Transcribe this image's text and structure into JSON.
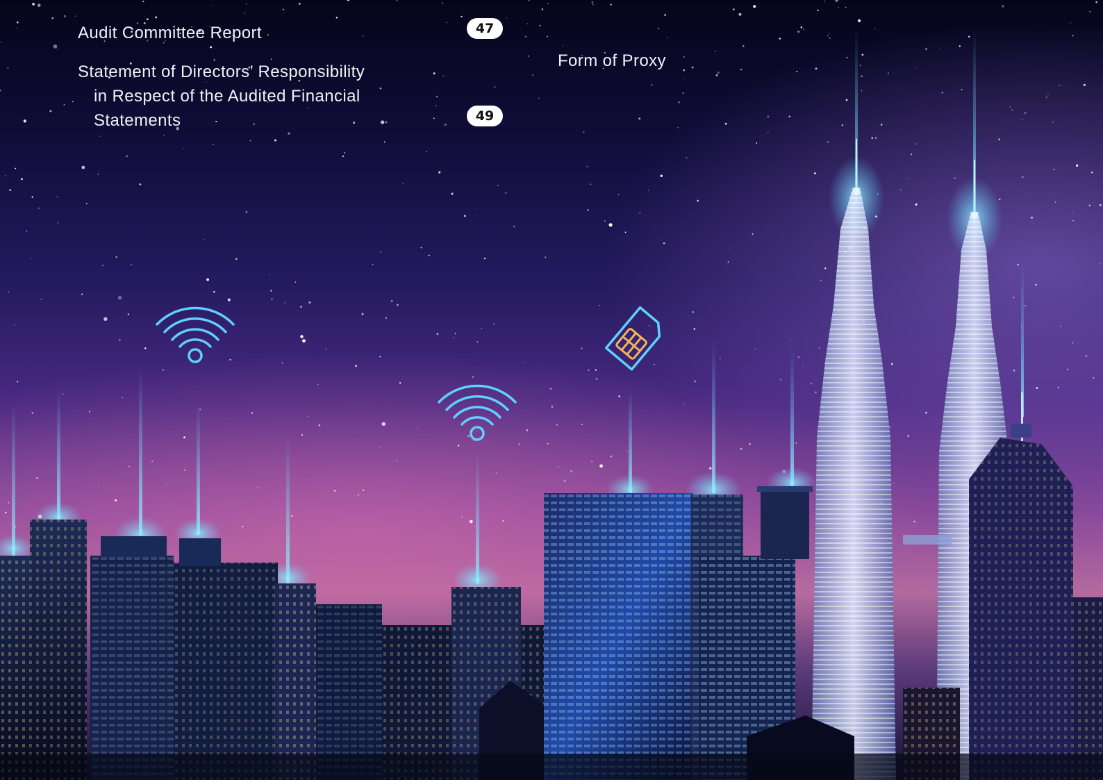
{
  "toc": {
    "entries": [
      {
        "title": "Audit Committee Report",
        "page": "47"
      },
      {
        "title_lines": [
          "Statement of Directors’ Responsibility",
          "in Respect of the Audited Financial",
          "Statements"
        ],
        "page": "49"
      },
      {
        "title": "Form of Proxy"
      }
    ]
  },
  "icons": [
    "wifi-icon",
    "wifi-icon",
    "sim-card-icon"
  ],
  "colors": {
    "neon_blue": "#5fd0ff",
    "neon_orange": "#f2b35a",
    "badge_bg": "#ffffff"
  }
}
